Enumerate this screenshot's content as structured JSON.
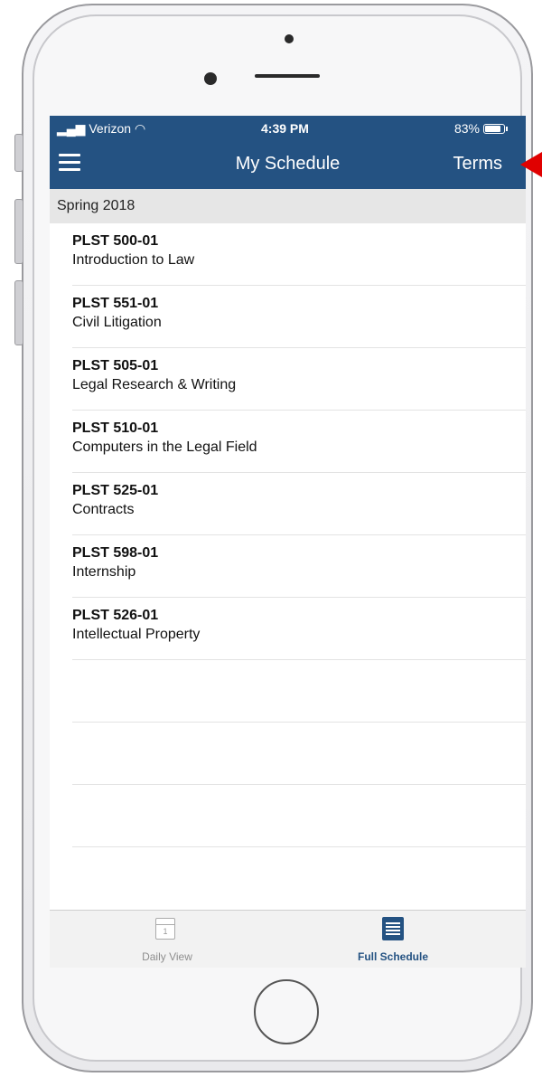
{
  "status_bar": {
    "carrier": "Verizon",
    "time": "4:39 PM",
    "battery": "83%"
  },
  "nav": {
    "title": "My Schedule",
    "terms_label": "Terms"
  },
  "section": {
    "header": "Spring 2018"
  },
  "courses": [
    {
      "code": "PLST 500-01",
      "name": "Introduction to Law"
    },
    {
      "code": "PLST 551-01",
      "name": "Civil Litigation"
    },
    {
      "code": "PLST 505-01",
      "name": "Legal Research & Writing"
    },
    {
      "code": "PLST 510-01",
      "name": "Computers in the Legal Field"
    },
    {
      "code": "PLST 525-01",
      "name": "Contracts"
    },
    {
      "code": "PLST 598-01",
      "name": "Internship"
    },
    {
      "code": "PLST 526-01",
      "name": "Intellectual Property"
    }
  ],
  "tabs": {
    "daily_label": "Daily View",
    "daily_icon_day": "1",
    "full_label": "Full Schedule"
  },
  "colors": {
    "brand_blue": "#245282",
    "arrow_red": "#e00000"
  }
}
